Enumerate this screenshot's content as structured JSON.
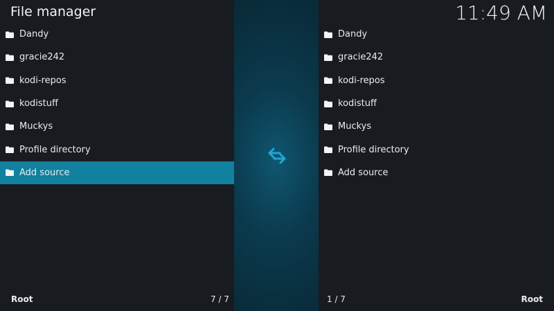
{
  "header": {
    "title": "File manager",
    "clock": "11:49 AM"
  },
  "left_pane": {
    "items": [
      {
        "label": "Dandy",
        "icon": "folder-icon"
      },
      {
        "label": "gracie242",
        "icon": "folder-icon"
      },
      {
        "label": "kodi-repos",
        "icon": "folder-icon"
      },
      {
        "label": "kodistuff",
        "icon": "folder-icon"
      },
      {
        "label": "Muckys",
        "icon": "folder-icon"
      },
      {
        "label": "Profile directory",
        "icon": "folder-icon"
      },
      {
        "label": "Add source",
        "icon": "folder-icon",
        "selected": true
      }
    ],
    "path": "Root",
    "position": "7 / 7"
  },
  "right_pane": {
    "items": [
      {
        "label": "Dandy",
        "icon": "folder-icon"
      },
      {
        "label": "gracie242",
        "icon": "folder-icon"
      },
      {
        "label": "kodi-repos",
        "icon": "folder-icon"
      },
      {
        "label": "kodistuff",
        "icon": "folder-icon"
      },
      {
        "label": "Muckys",
        "icon": "folder-icon"
      },
      {
        "label": "Profile directory",
        "icon": "folder-icon"
      },
      {
        "label": "Add source",
        "icon": "folder-icon"
      }
    ],
    "path": "Root",
    "position": "1 / 7"
  },
  "divider": {
    "icon": "swap-arrows-icon"
  },
  "colors": {
    "selection": "#12809f",
    "background": "#181c21",
    "accent": "#1fa6d6"
  }
}
